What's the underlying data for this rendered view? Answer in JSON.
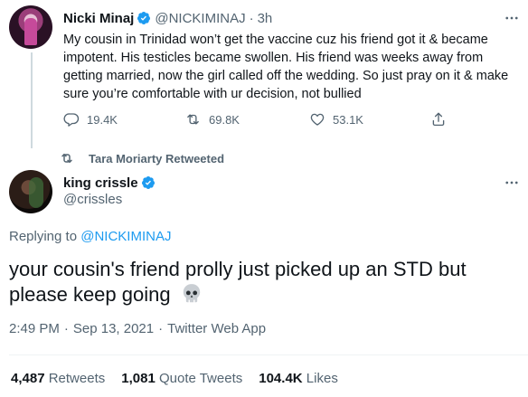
{
  "parent_tweet": {
    "name": "Nicki Minaj",
    "handle": "@NICKIMINAJ",
    "time": "3h",
    "text": "My cousin in Trinidad won’t get the vaccine cuz his friend got it & became impotent. His testicles became swollen. His friend was weeks away from getting married, now the girl called off the wedding. So just pray on it & make sure you’re comfortable with ur decision, not bullied",
    "replies": "19.4K",
    "retweets": "69.8K",
    "likes": "53.1K"
  },
  "retweet_context": "Tara Moriarty Retweeted",
  "main_tweet": {
    "name": "king crissle",
    "handle": "@crissles",
    "replying_prefix": "Replying to",
    "replying_to": "@NICKIMINAJ",
    "text": "your cousin's friend prolly just picked up an STD but please keep going",
    "emoji": "skull-icon",
    "time": "2:49 PM",
    "date": "Sep 13, 2021",
    "source": "Twitter Web App",
    "retweets_count": "4,487",
    "retweets_label": "Retweets",
    "quotes_count": "1,081",
    "quotes_label": "Quote Tweets",
    "likes_count": "104.4K",
    "likes_label": "Likes"
  },
  "colors": {
    "accent": "#1d9bf0",
    "secondary_text": "#536471",
    "primary_text": "#0f1419"
  }
}
